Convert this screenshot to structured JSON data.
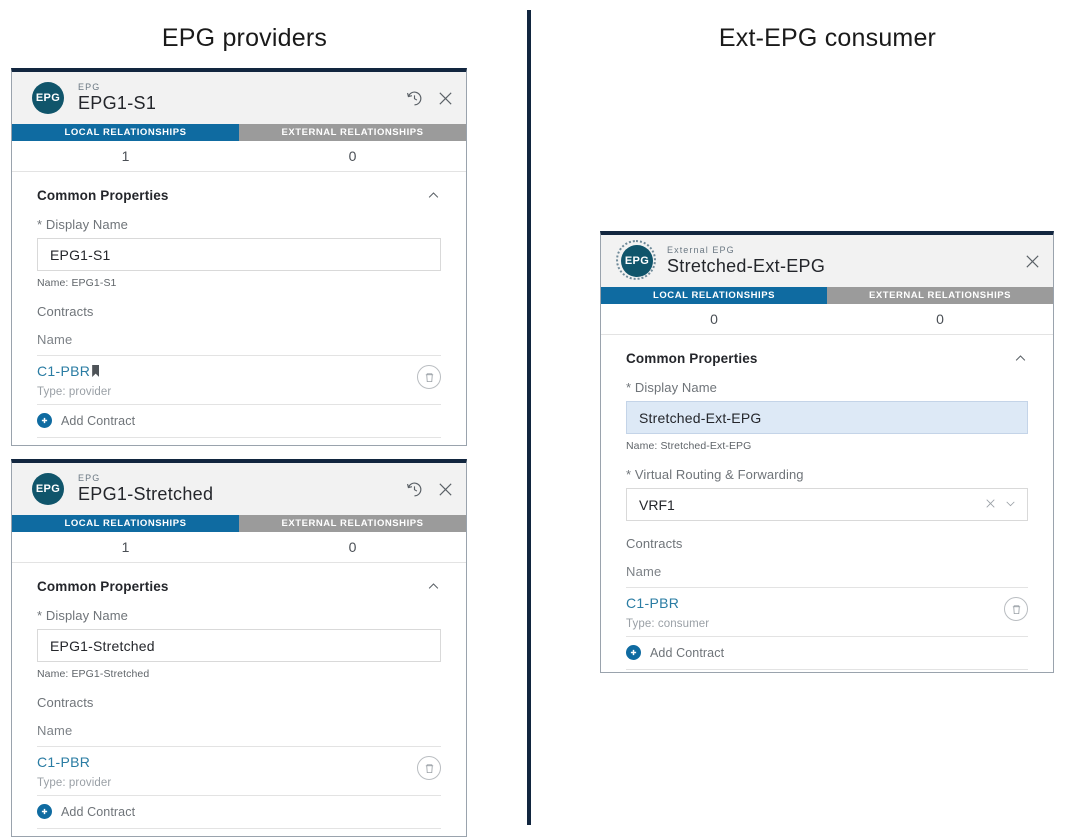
{
  "sections": {
    "left_title": "EPG providers",
    "right_title": "Ext-EPG consumer"
  },
  "common": {
    "tab_local": "LOCAL RELATIONSHIPS",
    "tab_external": "EXTERNAL RELATIONSHIPS",
    "common_properties": "Common Properties",
    "display_name_label": "* Display Name",
    "contracts_label": "Contracts",
    "name_column": "Name",
    "add_contract": "Add Contract",
    "vrf_label": "* Virtual Routing & Forwarding",
    "accent_blue": "#0f6ba1",
    "inactive_gray": "#9b9b9b",
    "avatar_teal": "#10556b",
    "card_top_navy": "#12263f",
    "link_blue": "#2a7ca3",
    "focus_blue_bg": "#dde9f6"
  },
  "cards": [
    {
      "id": "epg1-s1",
      "avatar_text": "EPG",
      "kicker": "EPG",
      "title": "EPG1-S1",
      "has_history_icon": true,
      "dashed_avatar": false,
      "local_count": "1",
      "external_count": "0",
      "display_name_value": "EPG1-S1",
      "display_name_focused": false,
      "name_helper": "Name: EPG1-S1",
      "has_vrf": false,
      "vrf_value": "",
      "contract_name": "C1-PBR",
      "contract_has_cursor_mark": true,
      "contract_type": "Type: provider"
    },
    {
      "id": "epg1-stretched",
      "avatar_text": "EPG",
      "kicker": "EPG",
      "title": "EPG1-Stretched",
      "has_history_icon": true,
      "dashed_avatar": false,
      "local_count": "1",
      "external_count": "0",
      "display_name_value": "EPG1-Stretched",
      "display_name_focused": false,
      "name_helper": "Name: EPG1-Stretched",
      "has_vrf": false,
      "vrf_value": "",
      "contract_name": "C1-PBR",
      "contract_has_cursor_mark": false,
      "contract_type": "Type: provider"
    },
    {
      "id": "stretched-ext-epg",
      "avatar_text": "EPG",
      "kicker": "External EPG",
      "title": "Stretched-Ext-EPG",
      "has_history_icon": false,
      "dashed_avatar": true,
      "local_count": "0",
      "external_count": "0",
      "display_name_value": "Stretched-Ext-EPG",
      "display_name_focused": true,
      "name_helper": "Name: Stretched-Ext-EPG",
      "has_vrf": true,
      "vrf_value": "VRF1",
      "contract_name": "C1-PBR",
      "contract_has_cursor_mark": false,
      "contract_type": "Type: consumer"
    }
  ]
}
